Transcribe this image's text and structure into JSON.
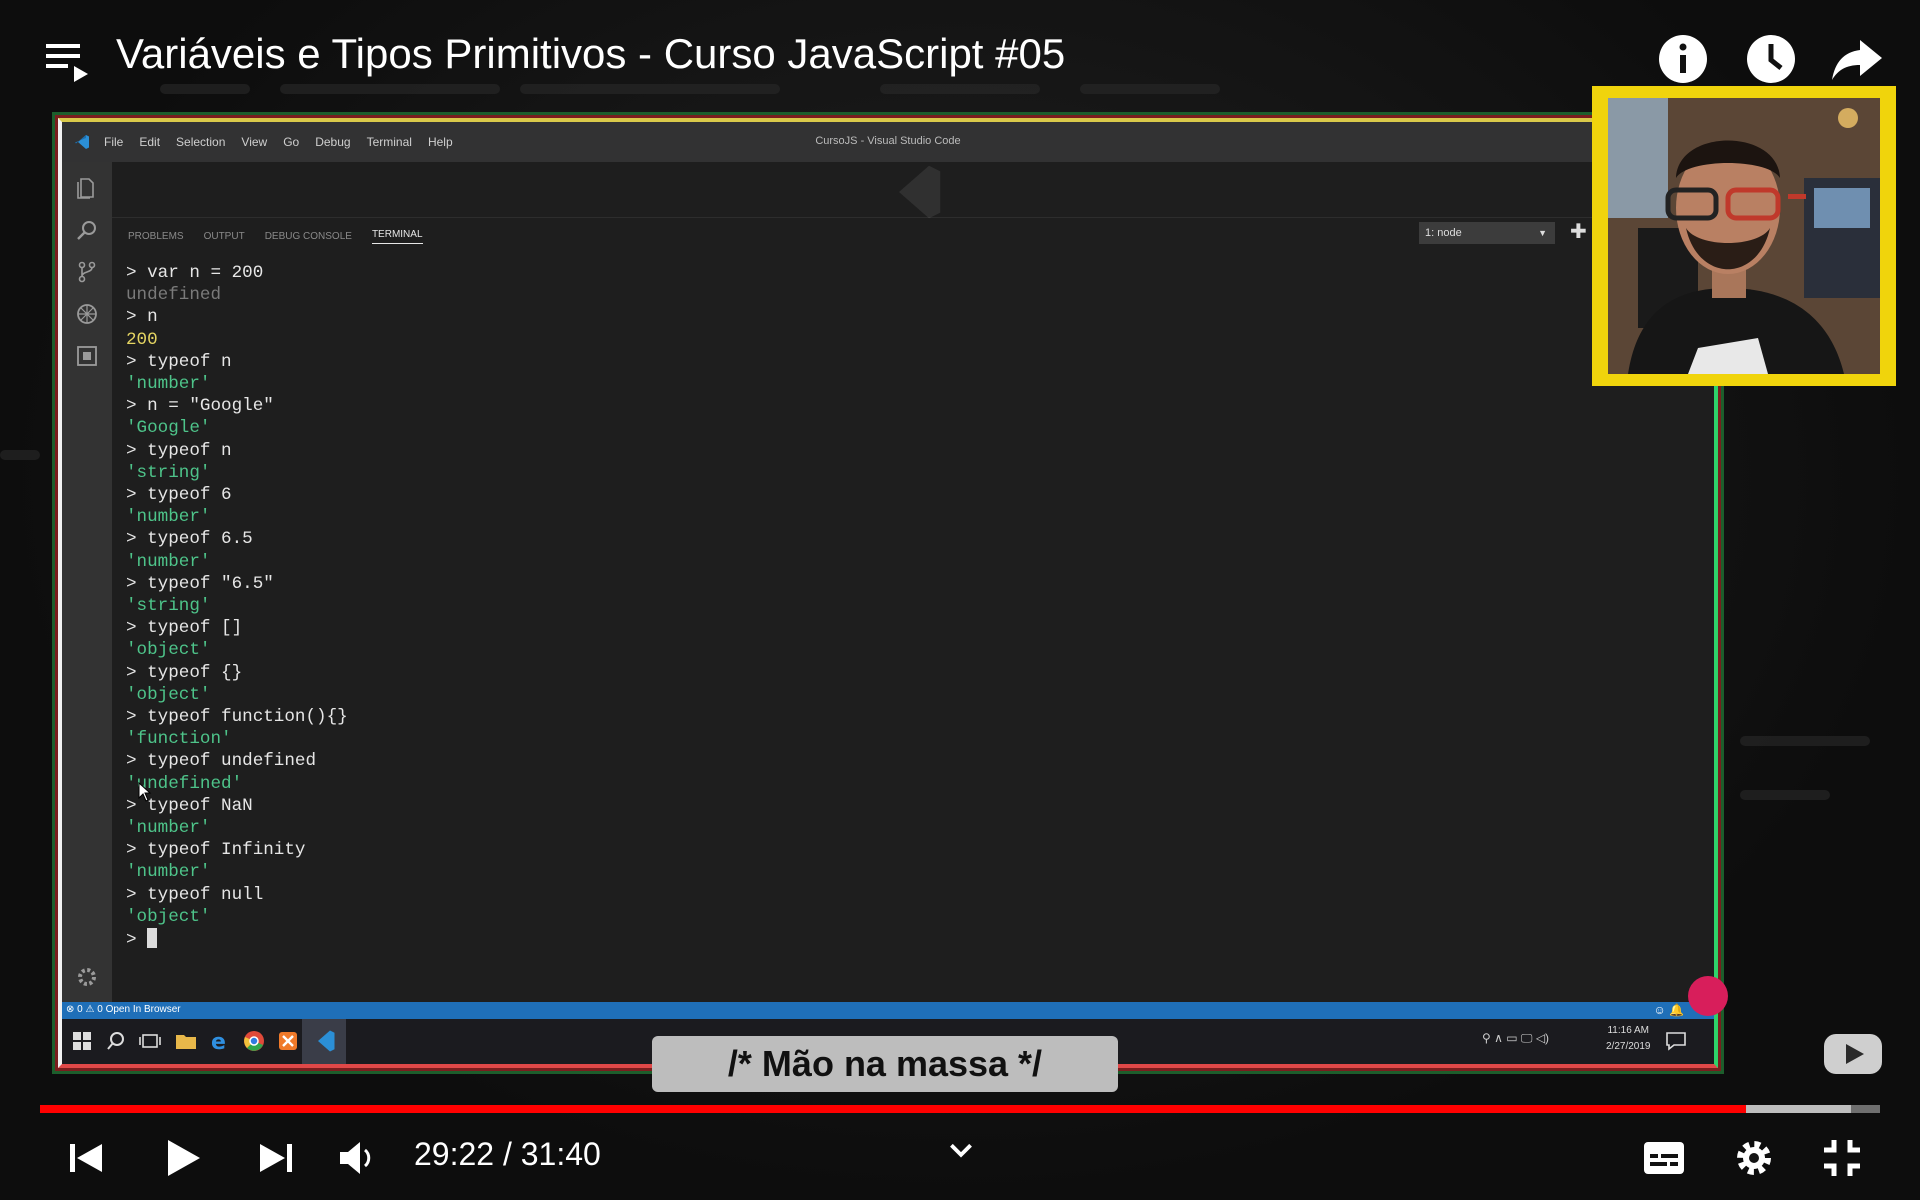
{
  "video": {
    "title": "Variáveis e Tipos Primitivos - Curso JavaScript #05",
    "caption": "/* Mão na massa */",
    "current_time": "29:22",
    "duration": "31:40",
    "time_separator": " / ",
    "progress_fraction": 0.9274,
    "buffered_fraction": 0.984
  },
  "vscode": {
    "window_title": "CursoJS - Visual Studio Code",
    "menu": [
      "File",
      "Edit",
      "Selection",
      "View",
      "Go",
      "Debug",
      "Terminal",
      "Help"
    ],
    "panel_tabs": [
      "PROBLEMS",
      "OUTPUT",
      "DEBUG CONSOLE",
      "TERMINAL"
    ],
    "active_panel_tab": "TERMINAL",
    "terminal_selector": "1: node",
    "terminal_lines": [
      {
        "text": "> var n = 200",
        "kind": "input"
      },
      {
        "text": "undefined",
        "kind": "undef"
      },
      {
        "text": "> n",
        "kind": "input"
      },
      {
        "text": "200",
        "kind": "num"
      },
      {
        "text": "> typeof n",
        "kind": "input"
      },
      {
        "text": "'number'",
        "kind": "str"
      },
      {
        "text": "> n = \"Google\"",
        "kind": "input"
      },
      {
        "text": "'Google'",
        "kind": "str"
      },
      {
        "text": "> typeof n",
        "kind": "input"
      },
      {
        "text": "'string'",
        "kind": "str"
      },
      {
        "text": "> typeof 6",
        "kind": "input"
      },
      {
        "text": "'number'",
        "kind": "str"
      },
      {
        "text": "> typeof 6.5",
        "kind": "input"
      },
      {
        "text": "'number'",
        "kind": "str"
      },
      {
        "text": "> typeof \"6.5\"",
        "kind": "input"
      },
      {
        "text": "'string'",
        "kind": "str"
      },
      {
        "text": "> typeof []",
        "kind": "input"
      },
      {
        "text": "'object'",
        "kind": "str"
      },
      {
        "text": "> typeof {}",
        "kind": "input"
      },
      {
        "text": "'object'",
        "kind": "str"
      },
      {
        "text": "> typeof function(){}",
        "kind": "input"
      },
      {
        "text": "'function'",
        "kind": "str"
      },
      {
        "text": "> typeof undefined",
        "kind": "input"
      },
      {
        "text": "'undefined'",
        "kind": "str"
      },
      {
        "text": "> typeof NaN",
        "kind": "input"
      },
      {
        "text": "'number'",
        "kind": "str"
      },
      {
        "text": "> typeof Infinity",
        "kind": "input"
      },
      {
        "text": "'number'",
        "kind": "str"
      },
      {
        "text": "> typeof null",
        "kind": "input"
      },
      {
        "text": "'object'",
        "kind": "str"
      }
    ],
    "prompt": "> ",
    "status_left": "⊗ 0 ⚠ 0   Open In Browser",
    "clock_time": "11:16 AM",
    "clock_date": "2/27/2019"
  },
  "colors": {
    "progress": "#ff0000",
    "webcam_border": "#f0d40c",
    "vscode_statusbar": "#1f6fb8",
    "terminal_string": "#4ec48a",
    "terminal_number": "#e5d562"
  },
  "icons": {
    "top": [
      "playlist-icon",
      "info-icon",
      "watch-later-icon",
      "share-icon"
    ],
    "controls": [
      "previous-icon",
      "play-icon",
      "next-icon",
      "volume-icon",
      "chevron-down-icon",
      "subtitles-icon",
      "settings-icon",
      "exit-fullscreen-icon"
    ]
  }
}
